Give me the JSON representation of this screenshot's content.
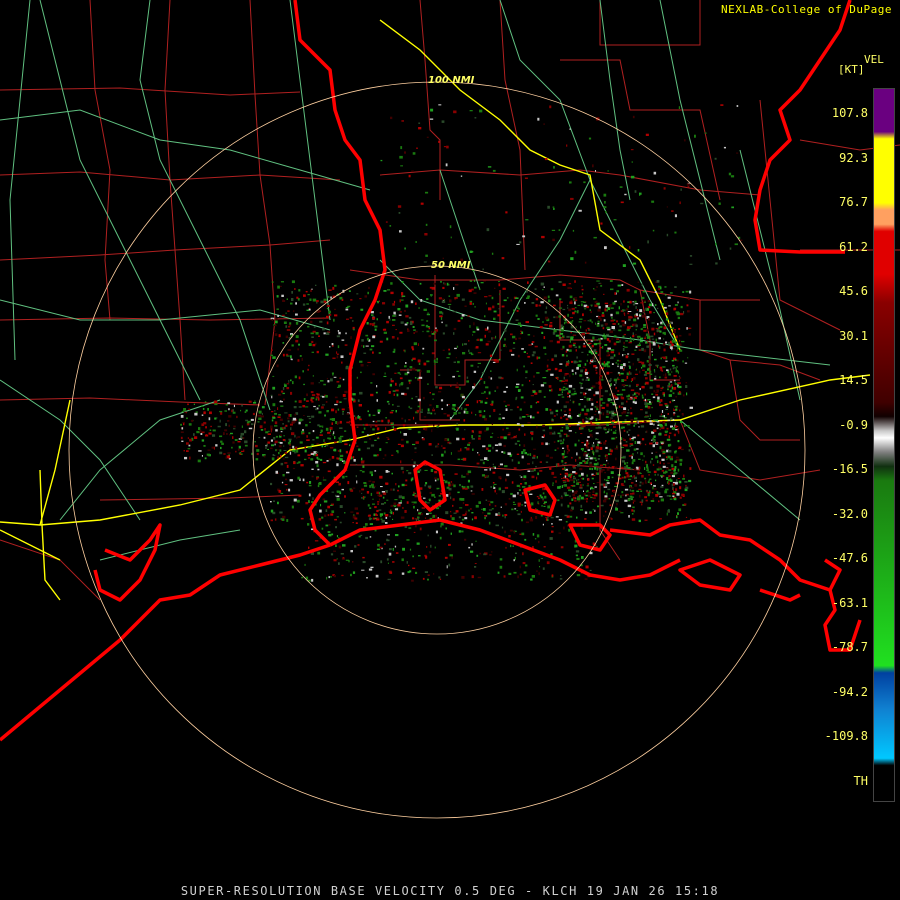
{
  "credit": "NEXLAB-College of DuPage",
  "footer": "SUPER-RESOLUTION BASE VELOCITY 0.5 DEG - KLCH 19 JAN 26 15:18",
  "legend": {
    "product": "VEL",
    "unit": "[KT]",
    "ticks": [
      "107.8",
      "92.3",
      "76.7",
      "61.2",
      "45.6",
      "30.1",
      "14.5",
      "-0.9",
      "-16.5",
      "-32.0",
      "-47.6",
      "-63.1",
      "-78.7",
      "-94.2",
      "-109.8",
      "TH"
    ],
    "colors": [
      "#6a0080",
      "#ffff00",
      "#ffa060",
      "#e00000",
      "#8a0000",
      "#400000",
      "#c8c8c8",
      "#1a7a10",
      "#20e020",
      "#1080d0",
      "#00c8ff"
    ]
  },
  "range_rings": {
    "inner_label": "50 NMI",
    "outer_label": "100 NMI"
  },
  "colors": {
    "coast": "#ff0000",
    "county": "#b02020",
    "road": "#60c080",
    "interstate": "#ffff00",
    "ring": "#ffd0a0"
  }
}
